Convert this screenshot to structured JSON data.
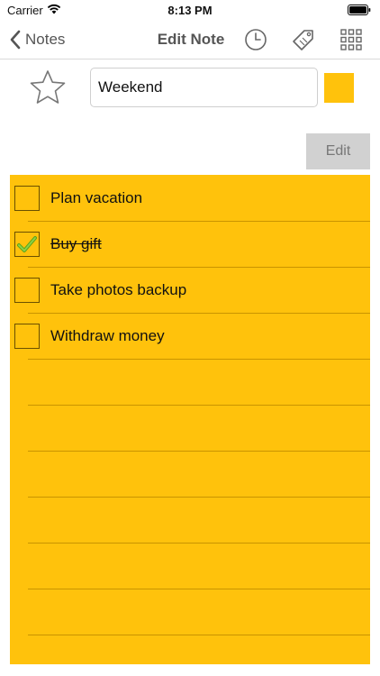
{
  "status_bar": {
    "carrier": "Carrier",
    "time": "8:13 PM"
  },
  "nav": {
    "back_label": "Notes",
    "title": "Edit Note",
    "icons": [
      "clock-icon",
      "tag-icon",
      "grid-icon"
    ]
  },
  "note": {
    "starred": false,
    "title": "Weekend",
    "color": "#ffc20c",
    "edit_label": "Edit",
    "items": [
      {
        "text": "Plan vacation",
        "checked": false
      },
      {
        "text": "Buy gift",
        "checked": true
      },
      {
        "text": "Take photos backup",
        "checked": false
      },
      {
        "text": "Withdraw money",
        "checked": false
      }
    ]
  }
}
